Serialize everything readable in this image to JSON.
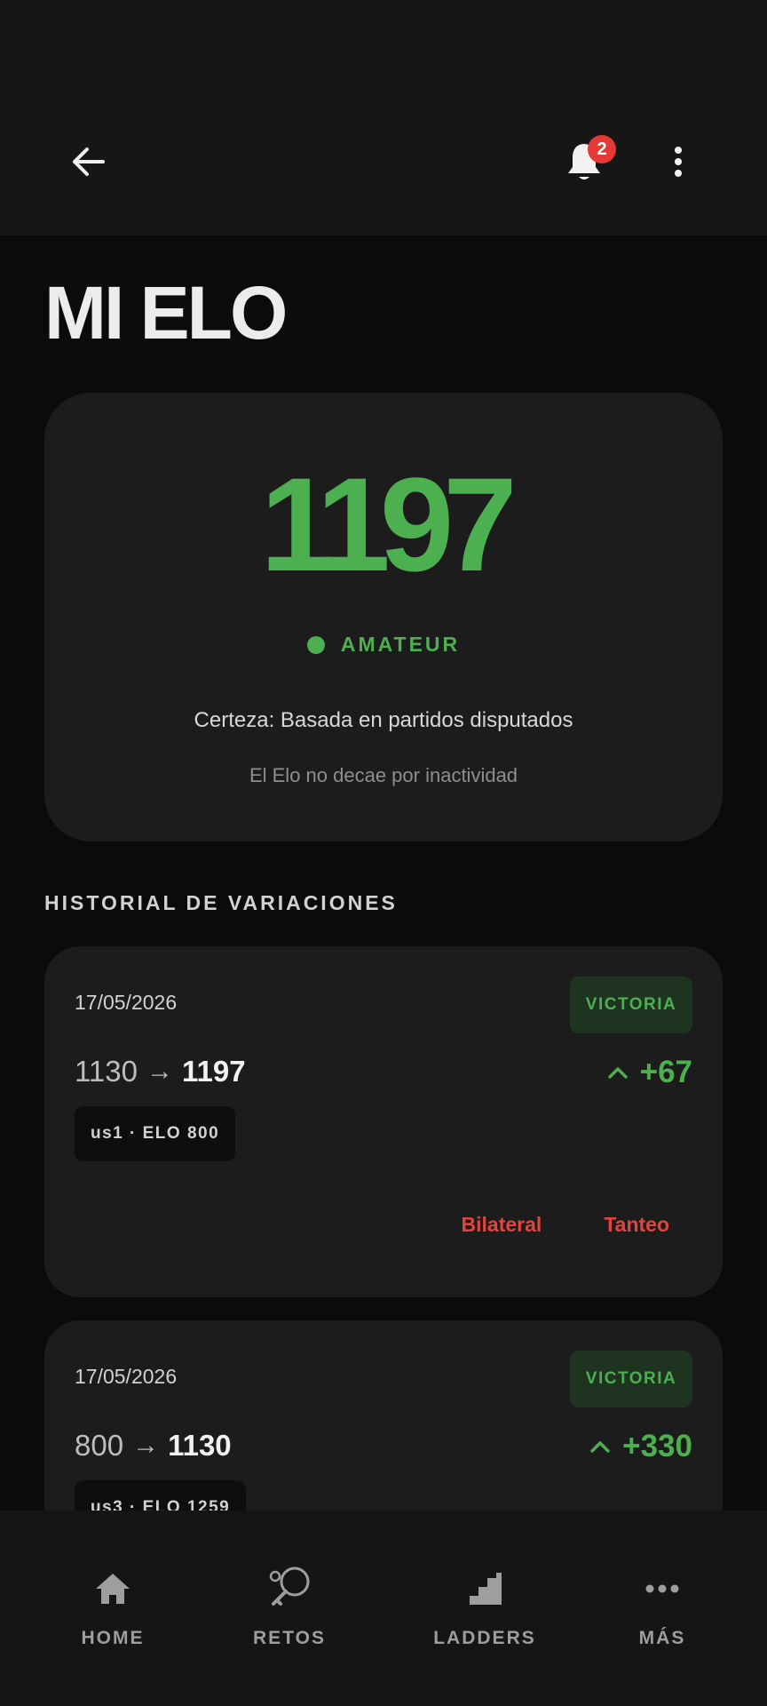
{
  "header": {
    "notification_count": "2"
  },
  "page": {
    "title": "MI ELO"
  },
  "elo_card": {
    "value": "1197",
    "level": "AMATEUR",
    "certainty": "Certeza: Basada en partidos disputados",
    "decay_note": "El Elo no decae por inactividad"
  },
  "history": {
    "section_title": "HISTORIAL DE VARIACIONES",
    "items": [
      {
        "date": "17/05/2026",
        "result": "VICTORIA",
        "from": "1130",
        "to": "1197",
        "delta": "+67",
        "opponent": "us1 · ELO 800",
        "tags": [
          "Bilateral",
          "Tanteo"
        ]
      },
      {
        "date": "17/05/2026",
        "result": "VICTORIA",
        "from": "800",
        "to": "1130",
        "delta": "+330",
        "opponent": "us3 · ELO 1259"
      }
    ]
  },
  "bottom_nav": {
    "items": [
      {
        "label": "HOME",
        "icon": "home-icon"
      },
      {
        "label": "RETOS",
        "icon": "paddle-icon"
      },
      {
        "label": "LADDERS",
        "icon": "ladder-icon"
      },
      {
        "label": "MÁS",
        "icon": "more-horizontal-icon"
      }
    ]
  },
  "colors": {
    "accent_green": "#4caf50",
    "badge_red": "#e53935",
    "tag_red": "#e0453e",
    "card_bg": "#1c1c1c",
    "page_bg": "#0b0b0b"
  }
}
